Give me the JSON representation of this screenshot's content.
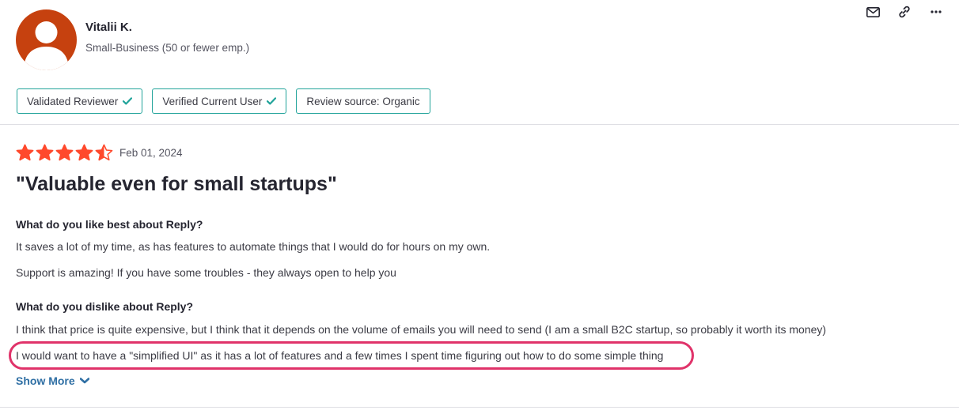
{
  "reviewer": {
    "name": "Vitalii K.",
    "segment": "Small-Business (50 or fewer emp.)"
  },
  "actions": [
    {
      "name": "mail-icon"
    },
    {
      "name": "link-icon"
    },
    {
      "name": "more-icon"
    }
  ],
  "badges": [
    {
      "label": "Validated Reviewer",
      "check": true
    },
    {
      "label": "Verified Current User",
      "check": true
    },
    {
      "label": "Review source: Organic",
      "check": false
    }
  ],
  "review": {
    "rating": 4.5,
    "date": "Feb 01, 2024",
    "title": "\"Valuable even for small startups\"",
    "questions": [
      {
        "heading": "What do you like best about Reply?",
        "paragraphs": [
          "It saves a lot of my time, as has features to automate things that I would do for hours on my own.",
          "Support is amazing! If you have some troubles - they always open to help you"
        ]
      },
      {
        "heading": "What do you dislike about Reply?",
        "paragraphs": [
          "I think that price is quite expensive, but I think that it depends on the volume of emails you will need to send (I am a small B2C startup, so probably it worth its money)",
          "I would want to have a \"simplified UI\" as it has a lot of features and a few times I spent time figuring out how to do some simple thing"
        ]
      }
    ],
    "show_more": "Show More"
  },
  "colors": {
    "star": "#ff492c",
    "badge_border": "#21a39a",
    "highlight": "#e0336a",
    "link": "#2f6fa4",
    "avatar_bg": "#c6410f"
  }
}
